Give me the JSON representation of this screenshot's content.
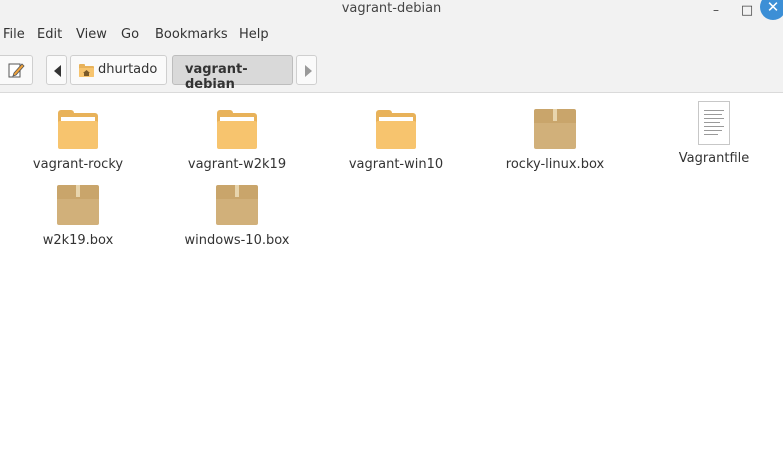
{
  "window": {
    "title": "vagrant-debian",
    "minimize_glyph": "–",
    "maximize_glyph": "□",
    "close_glyph": "✕"
  },
  "menu": {
    "items": [
      {
        "label": "File"
      },
      {
        "label": "Edit"
      },
      {
        "label": "View"
      },
      {
        "label": "Go"
      },
      {
        "label": "Bookmarks"
      },
      {
        "label": "Help"
      }
    ]
  },
  "toolbar": {
    "breadcrumbs": [
      {
        "label": "dhurtado",
        "icon": "home-folder-icon"
      },
      {
        "label": "vagrant-debian",
        "active": true
      }
    ]
  },
  "files": [
    {
      "name": "vagrant-rocky",
      "type": "folder"
    },
    {
      "name": "vagrant-w2k19",
      "type": "folder"
    },
    {
      "name": "vagrant-win10",
      "type": "folder"
    },
    {
      "name": "rocky-linux.box",
      "type": "package"
    },
    {
      "name": "Vagrantfile",
      "type": "text"
    },
    {
      "name": "w2k19.box",
      "type": "package"
    },
    {
      "name": "windows-10.box",
      "type": "package"
    }
  ],
  "colors": {
    "folder": "#f7c46e",
    "package": "#d1b07a",
    "close_button": "#3c8fd6",
    "active_crumb": "#d9d9d9"
  }
}
